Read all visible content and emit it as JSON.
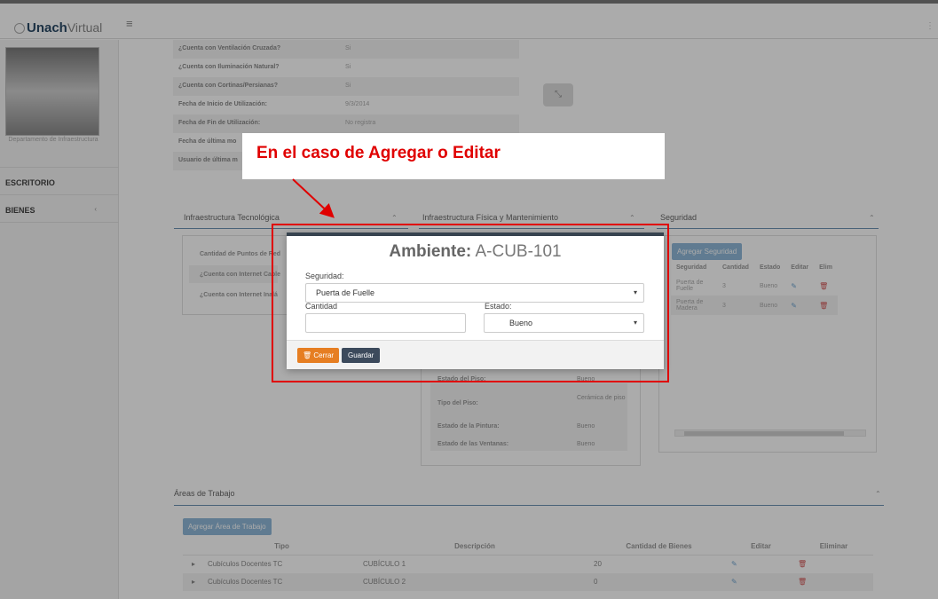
{
  "header": {
    "logo_brand": "Unach",
    "logo_suffix": "Virtual",
    "menu_icon": "hamburger-icon"
  },
  "sidebar": {
    "department": "Departamento de Infraestructura",
    "items": [
      {
        "label": "ESCRITORIO"
      },
      {
        "label": "BIENES",
        "chevron": "‹"
      }
    ]
  },
  "info": {
    "rows": [
      {
        "key": "¿Cuenta con Ventilación Cruzada?",
        "value": "Si"
      },
      {
        "key": "¿Cuenta con Iluminación Natural?",
        "value": "Si"
      },
      {
        "key": "¿Cuenta con Cortinas/Persianas?",
        "value": "Si"
      },
      {
        "key": "Fecha de Inicio de Utilización:",
        "value": "9/3/2014"
      },
      {
        "key": "Fecha de Fin de Utilización:",
        "value": "No registra"
      },
      {
        "key": "Fecha de última mo",
        "value": ""
      },
      {
        "key": "Usuario de última m",
        "value": ""
      }
    ]
  },
  "sections": {
    "tecnologica": "Infraestructura Tecnológica",
    "fisica": "Infraestructura Física y Mantenimiento",
    "seguridad": "Seguridad",
    "areas": "Áreas de Trabajo"
  },
  "tecnologica_rows": [
    "Cantidad de Puntos de Red",
    "¿Cuenta con Internet Cable",
    "¿Cuenta con Internet Inalá"
  ],
  "fisica_rows": [
    {
      "key": "Estado del Piso:",
      "value": "Bueno"
    },
    {
      "key": "Tipo del Piso:",
      "value": "Cerámica de piso"
    },
    {
      "key": "Estado de la Pintura:",
      "value": "Bueno"
    },
    {
      "key": "Estado de las Ventanas:",
      "value": "Bueno"
    }
  ],
  "seguridad_table": {
    "add_button": "Agregar Seguridad",
    "headers": [
      "Seguridad",
      "Cantidad",
      "Estado",
      "Editar",
      "Elim"
    ],
    "rows": [
      {
        "seguridad": "Puerta de Fuelle",
        "cantidad": "3",
        "estado": "Bueno"
      },
      {
        "seguridad": "Puerta de Madera",
        "cantidad": "3",
        "estado": "Bueno"
      }
    ]
  },
  "areas_table": {
    "add_button": "Agregar Área de Trabajo",
    "headers": [
      "Tipo",
      "Descripción",
      "Cantidad de Bienes",
      "Editar",
      "Eliminar"
    ],
    "rows": [
      {
        "tipo": "Cubículos Docentes TC",
        "descripcion": "CUBÍCULO 1",
        "cantidad": "20"
      },
      {
        "tipo": "Cubículos Docentes TC",
        "descripcion": "CUBÍCULO 2",
        "cantidad": "0"
      }
    ]
  },
  "modal": {
    "title_prefix": "Ambiente:",
    "title_value": "A-CUB-101",
    "seguridad_label": "Seguridad:",
    "seguridad_value": "Puerta de Fuelle",
    "cantidad_label": "Cantidad",
    "cantidad_value": "",
    "estado_label": "Estado:",
    "estado_value": "Bueno",
    "cerrar_label": "Cerrar",
    "guardar_label": "Guardar"
  },
  "annotation": {
    "text": "En el caso de Agregar o Editar",
    "color": "#e00000"
  }
}
